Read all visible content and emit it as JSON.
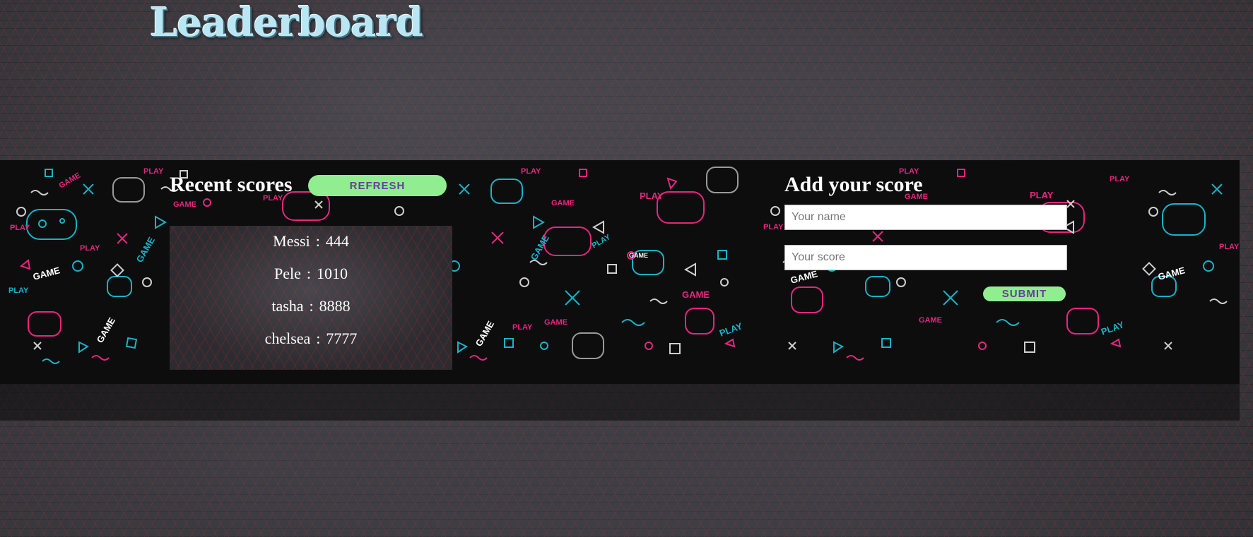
{
  "page": {
    "title": "Leaderboard"
  },
  "recent": {
    "title": "Recent scores",
    "refresh_label": "REFRESH",
    "scores": [
      {
        "name": "Messi",
        "sep": ":",
        "score": "444"
      },
      {
        "name": "Pele",
        "sep": ":",
        "score": "1010"
      },
      {
        "name": "tasha",
        "sep": ":",
        "score": "8888"
      },
      {
        "name": "chelsea",
        "sep": ":",
        "score": "7777"
      }
    ]
  },
  "add": {
    "title": "Add your score",
    "name_placeholder": "Your name",
    "score_placeholder": "Your score",
    "submit_label": "SUBMIT"
  },
  "colors": {
    "title_text": "#b9e6f2",
    "button_bg": "#90ee90",
    "button_text": "#6a3d9a",
    "pattern_pink": "#e5267f",
    "pattern_cyan": "#17b3c9",
    "band_bg": "#0d0d0d"
  },
  "decor_text": {
    "game": "GAME",
    "play": "PLAY"
  }
}
